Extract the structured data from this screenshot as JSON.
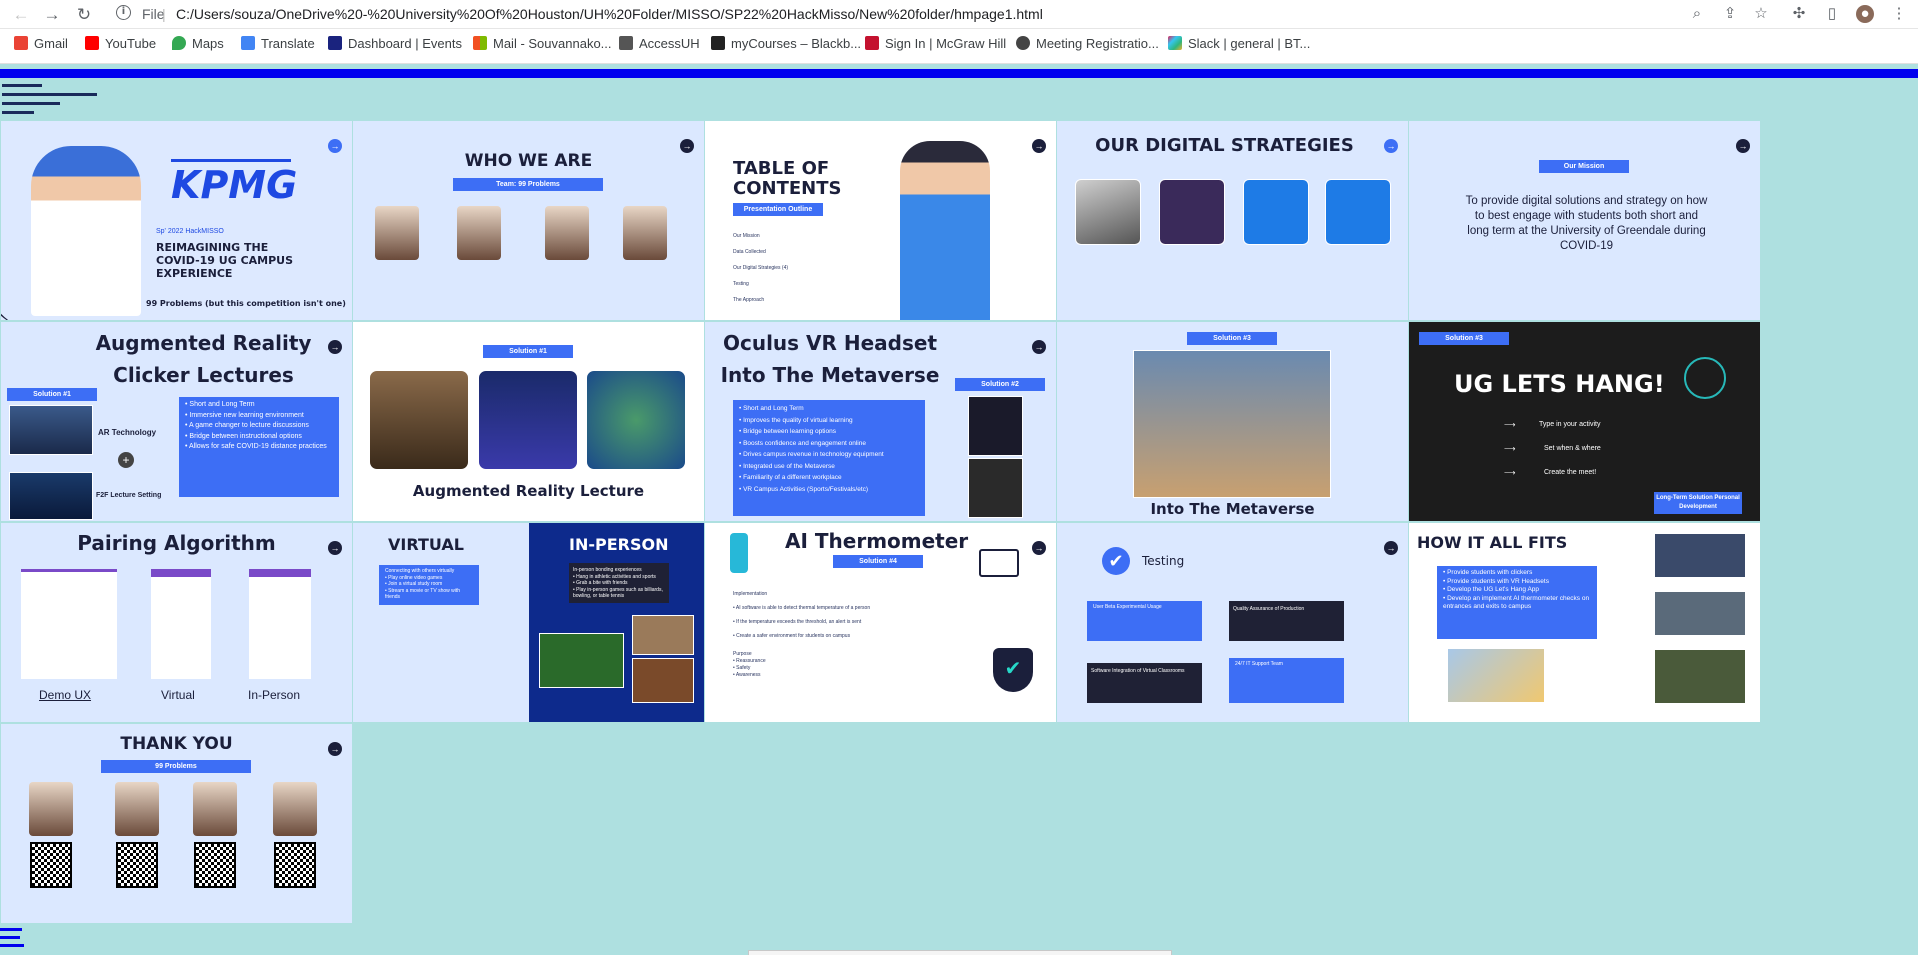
{
  "browser": {
    "file_label": "File",
    "url": "C:/Users/souza/OneDrive%20-%20University%20Of%20Houston/UH%20Folder/MISSO/SP22%20HackMisso/New%20folder/hmpage1.html"
  },
  "bookmarks": [
    {
      "label": "Gmail",
      "color": "#ea4335"
    },
    {
      "label": "YouTube",
      "color": "#ff0000"
    },
    {
      "label": "Maps",
      "color": "#34a853"
    },
    {
      "label": "Translate",
      "color": "#4285f4"
    },
    {
      "label": "Dashboard | Events",
      "color": "#1a237e"
    },
    {
      "label": "Mail - Souvannako...",
      "color": "#f25022"
    },
    {
      "label": "AccessUH",
      "color": "#555555"
    },
    {
      "label": "myCourses – Blackb...",
      "color": "#222222"
    },
    {
      "label": "Sign In | McGraw Hill",
      "color": "#c4122f"
    },
    {
      "label": "Meeting Registratio...",
      "color": "#444444"
    },
    {
      "label": "Slack | general | BT...",
      "color": "#4a154b"
    }
  ],
  "slides": {
    "s1": {
      "logo": "KPMG",
      "event": "Sp' 2022 HackMISSO",
      "title": "REIMAGINING THE COVID-19 UG CAMPUS EXPERIENCE",
      "team": "99 Problems (but this competition isn't one)"
    },
    "s2": {
      "title": "WHO WE ARE",
      "pill": "Team: 99 Problems"
    },
    "s3": {
      "title": "TABLE OF CONTENTS",
      "pill": "Presentation Outline",
      "items": [
        "Our Mission",
        "Data Collected",
        "Our Digital Strategies (4)",
        "Testing",
        "The Approach"
      ]
    },
    "s4": {
      "title": "OUR DIGITAL STRATEGIES"
    },
    "s5": {
      "pill": "Our Mission",
      "text": "To provide digital solutions and strategy on how to best engage with students both short and long term at the University of Greendale during COVID-19"
    },
    "s6": {
      "title": "Augmented Reality Clicker Lectures",
      "pill": "Solution #1",
      "label_a": "AR Technology",
      "label_b": "F2F Lecture Setting"
    },
    "s7": {
      "pill": "Solution #1",
      "caption": "Augmented Reality Lecture"
    },
    "s8": {
      "title": "Oculus VR Headset Into The Metaverse",
      "pill": "Solution #2"
    },
    "s9": {
      "pill": "Solution #3",
      "caption": "Into The Metaverse"
    },
    "s10": {
      "pill": "Solution #3",
      "title": "UG LETS HANG!",
      "steps": [
        "Type in your activity",
        "Set when & where",
        "Create the meet!"
      ],
      "badge": "Long-Term Solution Personal Development"
    },
    "s11": {
      "title": "Pairing Algorithm",
      "labels": [
        "Demo UX",
        "Virtual",
        "In-Person"
      ]
    },
    "s12": {
      "left": "VIRTUAL",
      "right": "IN-PERSON"
    },
    "s13": {
      "title": "AI Thermometer",
      "pill": "Solution #4"
    },
    "s14": {
      "title": "Testing"
    },
    "s15": {
      "title": "HOW IT ALL FITS"
    },
    "s16": {
      "title": "THANK YOU",
      "pill": "99 Problems"
    }
  }
}
